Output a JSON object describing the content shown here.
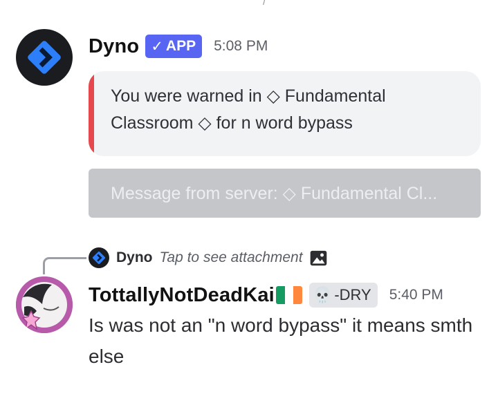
{
  "top_fragment": "/",
  "message1": {
    "author": "Dyno",
    "badge": {
      "check": "✓",
      "label": "APP"
    },
    "timestamp": "5:08 PM",
    "embed": {
      "text": "You were warned in ◇ Fundamental Classroom ◇ for n word bypass",
      "accent_color": "#e5484d"
    },
    "server_button": "Message from server: ◇ Fundamental Cl..."
  },
  "reply": {
    "author": "Dyno",
    "text": "Tap to see attachment",
    "icon": "image-icon"
  },
  "message2": {
    "author": "TottallyNotDeadKai",
    "flag": "ireland-flag",
    "role_badge": {
      "emoji": "💀",
      "label": "-DRY"
    },
    "timestamp": "5:40 PM",
    "body": "Is was not an \"n word bypass\" it means smth else"
  },
  "colors": {
    "app_badge": "#5865f2",
    "embed_bg": "#f2f3f5",
    "server_button_bg": "#c4c6ca",
    "avatar_dyno_bg": "#1a1c20",
    "dyno_logo_blue": "#2d7ff9"
  }
}
